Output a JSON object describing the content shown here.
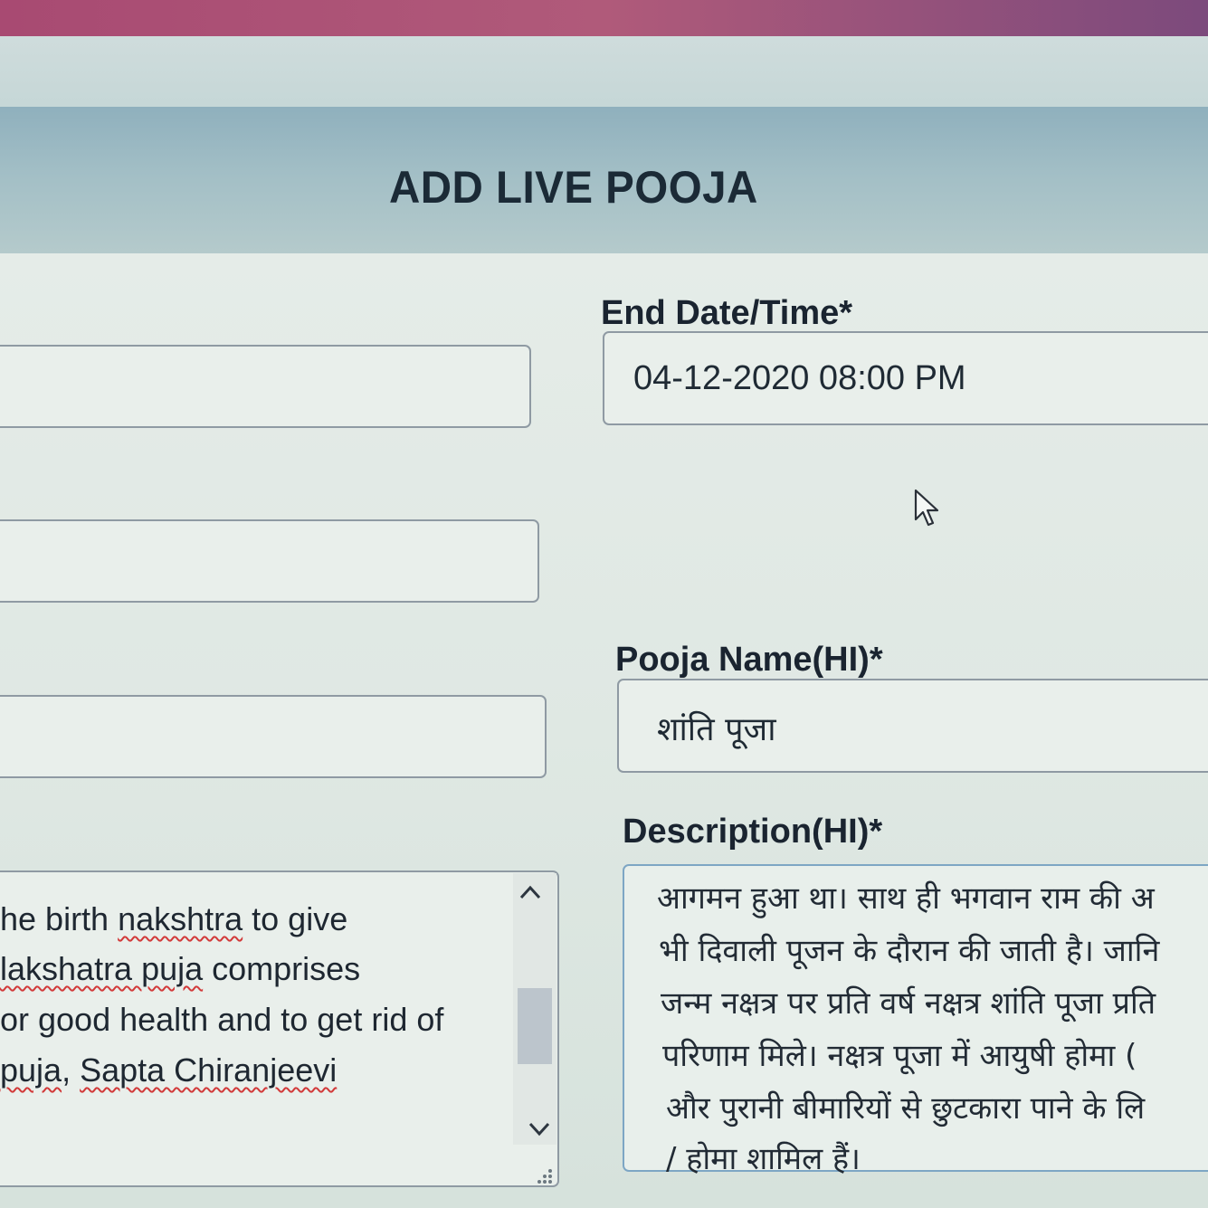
{
  "page": {
    "title": "ADD LIVE POOJA"
  },
  "fields": {
    "end_datetime": {
      "label": "End Date/Time*",
      "value": "04-12-2020 08:00 PM"
    },
    "pooja_name_hi": {
      "label": "Pooja Name(HI)*",
      "value": "शांति पूजा"
    },
    "description_hi": {
      "label": "Description(HI)*",
      "lines": [
        "आगमन हुआ था। साथ ही भगवान राम की अ",
        "भी दिवाली पूजन के दौरान की जाती है। जानि",
        "जन्म नक्षत्र पर प्रति वर्ष नक्षत्र शांति पूजा प्रति",
        "परिणाम मिले। नक्षत्र पूजा में आयुषी होमा (",
        "और पुरानी बीमारियों से छुटकारा पाने के लि",
        "/ होमा शामिल हैं।"
      ]
    },
    "description_en": {
      "lines": [
        {
          "plain_before": "he birth ",
          "underlined": "nakshtra",
          "plain_after": " to give"
        },
        {
          "plain_before": "",
          "underlined": "lakshatra puja",
          "plain_after": " comprises"
        },
        {
          "plain_before": "or good health and to get rid of",
          "underlined": "",
          "plain_after": ""
        },
        {
          "plain_before": "",
          "underlined": "puja",
          "plain_after": ", ",
          "underlined2": "Sapta Chiranjeevi"
        }
      ]
    }
  },
  "icons": {
    "scroll_up": "chevron-up-icon",
    "scroll_down": "chevron-down-icon",
    "cursor": "mouse-pointer-icon",
    "resize": "resize-grip-icon"
  },
  "colors": {
    "header_band": "#a3bfc6",
    "form_background": "#e5ece8",
    "field_border": "#8f9aa3",
    "text": "#1a2430",
    "spell_error": "#d23a3a"
  }
}
